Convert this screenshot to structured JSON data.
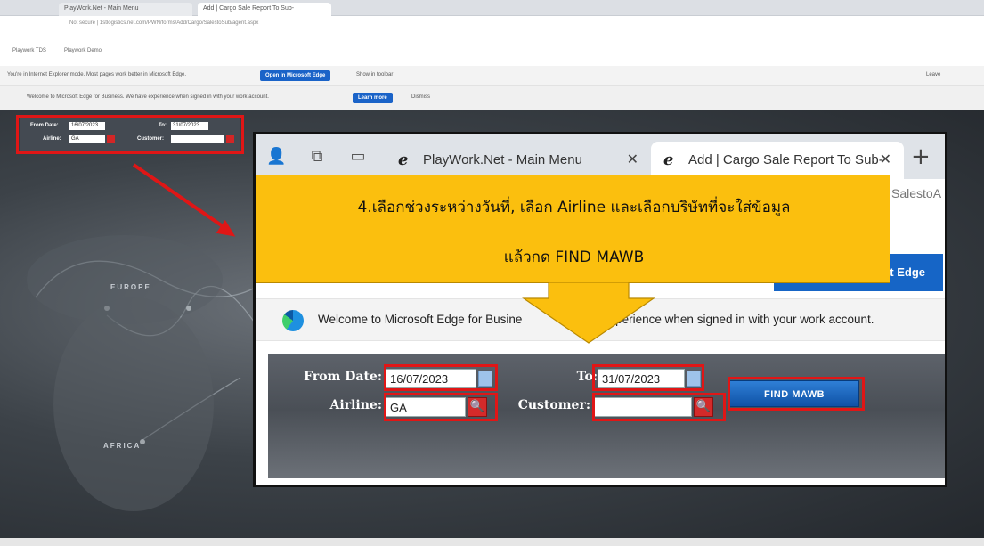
{
  "background_browser": {
    "tabs": [
      "PlayWork.Net - Main Menu",
      "Add | Cargo Sale Report To Sub-"
    ],
    "address": "Not secure | 1stlogistics.net.com/PWN/forms/Add/Cargo/SalestoSub/agent.aspx",
    "favorites": [
      "Playwork TDS",
      "Playwork Demo"
    ],
    "ie_bar_text": "You're in Internet Explorer mode. Most pages work better in Microsoft Edge.",
    "ie_bar_button": "Open in Microsoft Edge",
    "ie_bar_link": "Show in toolbar",
    "ie_bar_right": "Leave",
    "welcome_text": "Welcome to Microsoft Edge for Business. We have experience when signed in with your work account.",
    "welcome_button": "Learn more",
    "welcome_link": "Dismiss",
    "mini_form": {
      "from_label": "From Date:",
      "from_value": "16/07/2023",
      "to_label": "To:",
      "to_value": "31/07/2023",
      "airline_label": "Airline:",
      "airline_value": "GA",
      "customer_label": "Customer:"
    },
    "continents": [
      "EUROPE",
      "AFRICA"
    ]
  },
  "zoom": {
    "tabs": [
      {
        "label": "PlayWork.Net - Main Menu"
      },
      {
        "label": "Add | Cargo Sale Report To Sub-"
      }
    ],
    "partial_text": "SalestoA",
    "edge_button_partial": "t Edge",
    "welcome_text": "Welcome to Microsoft Edge for Busine",
    "welcome_text_tail": "new experience when signed in with your work account.",
    "form": {
      "from_label": "From Date:",
      "from_value": "16/07/2023",
      "to_label": "To:",
      "to_value": "31/07/2023",
      "airline_label": "Airline:",
      "airline_value": "GA",
      "customer_label": "Customer:",
      "customer_value": "",
      "find_button": "FIND MAWB"
    }
  },
  "callout": {
    "line1": "4.เลือกช่วงระหว่างวันที่, เลือก Airline และเลือกบริษัทที่จะใส่ข้อมูล",
    "line2": "แล้วกด FIND MAWB",
    "color": "#fbbf0e"
  },
  "colors": {
    "highlight": "#e01616",
    "find_button": "#1a66c4"
  }
}
